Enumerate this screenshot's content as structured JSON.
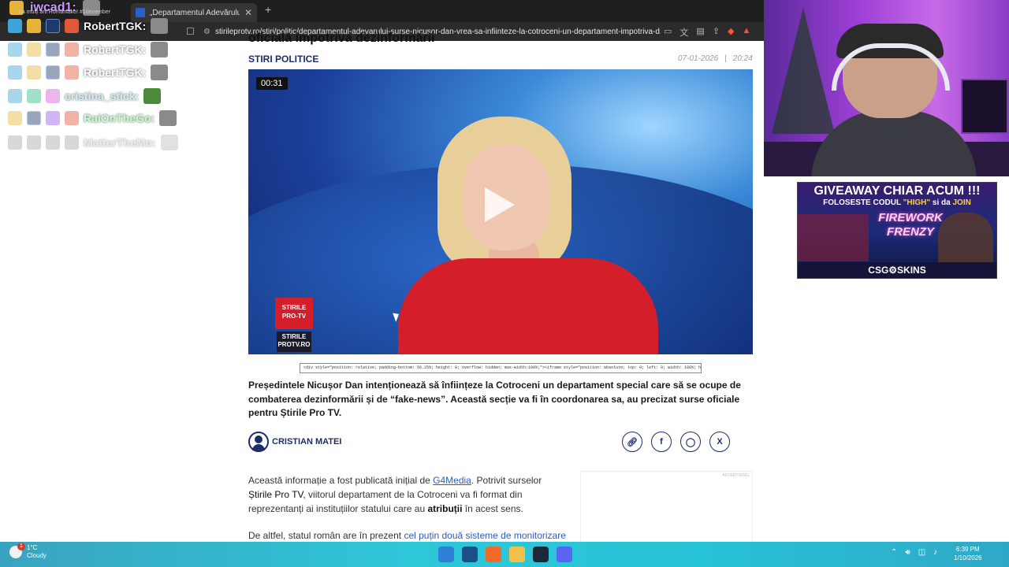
{
  "browser": {
    "tab_title": "„Departamentul Adevărului\". Sur",
    "url": "stirileprotv.ro/stiri/politic/departamentul-adevarului-surse-nicusor-dan-vrea-sa-infiinteze-la-cotroceni-un-departament-impotriva-d..."
  },
  "chat": {
    "top_user": "iwcad1:",
    "top_sub": "La mulți ani Romaniako! #1december",
    "users": [
      "RobertTGK:",
      "RobertTGK:",
      "RobertTGK:",
      "cristina_stick:",
      "RaiOnTheGo:",
      "MatterTheMo:"
    ]
  },
  "article": {
    "headline_cut": "oficială împotriva dezinformării",
    "category": "STIRI POLITICE",
    "date": "07-01-2026",
    "time": "20:24",
    "video_time": "00:31",
    "logo_text_1": "STIRILE PRO-TV",
    "logo_text_2": "STIRILE PROTV.RO",
    "embed_code": "<div style=\"position: relative; padding-bottom: 56.25%; height: 0; overflow: hidden; max-width:100%;\"><iframe style=\"position: absolute; top: 0; left: 0; width: 100%; height: 100%;\"",
    "lead": "Președintele Nicușor Dan intenționează să înființeze la Cotroceni un departament special care să se ocupe de combaterea dezinformării și de “fake-news”. Această secție va fi în coordonarea sa, au precizat surse oficiale pentru Știrile Pro TV.",
    "author": "CRISTIAN MATEI",
    "p1_a": "Această informație a fost publicată inițial de ",
    "p1_link": "G4Media",
    "p1_b": ". Potrivit surselor ",
    "p1_c": "Știrile Pro TV",
    "p1_d": ", viitorul departament de la Cotroceni va fi  format din reprezentanți ai instituțiilor statului care au ",
    "p1_e": "atribuții",
    "p1_f": " în acest sens.",
    "p2_a": "De altfel, statul român are în prezent ",
    "p2_link": "cel puțin două sisteme de monitorizare",
    "ad_label": "ADVERTISING"
  },
  "giveaway": {
    "line1": "GIVEAWAY CHIAR ACUM !!!",
    "line2_a": "FOLOSESTE CODUL ",
    "line2_code": "\"HIGH\"",
    "line2_b": " si da ",
    "line2_join": "JOIN",
    "game_title": "FIREWORK FRENZY",
    "brand": "CSG⚙SKINS"
  },
  "taskbar": {
    "weather_temp": "1°C",
    "weather_desc": "Cloudy",
    "notif_count": "1",
    "time": "6:39 PM",
    "date": "1/10/2026"
  }
}
